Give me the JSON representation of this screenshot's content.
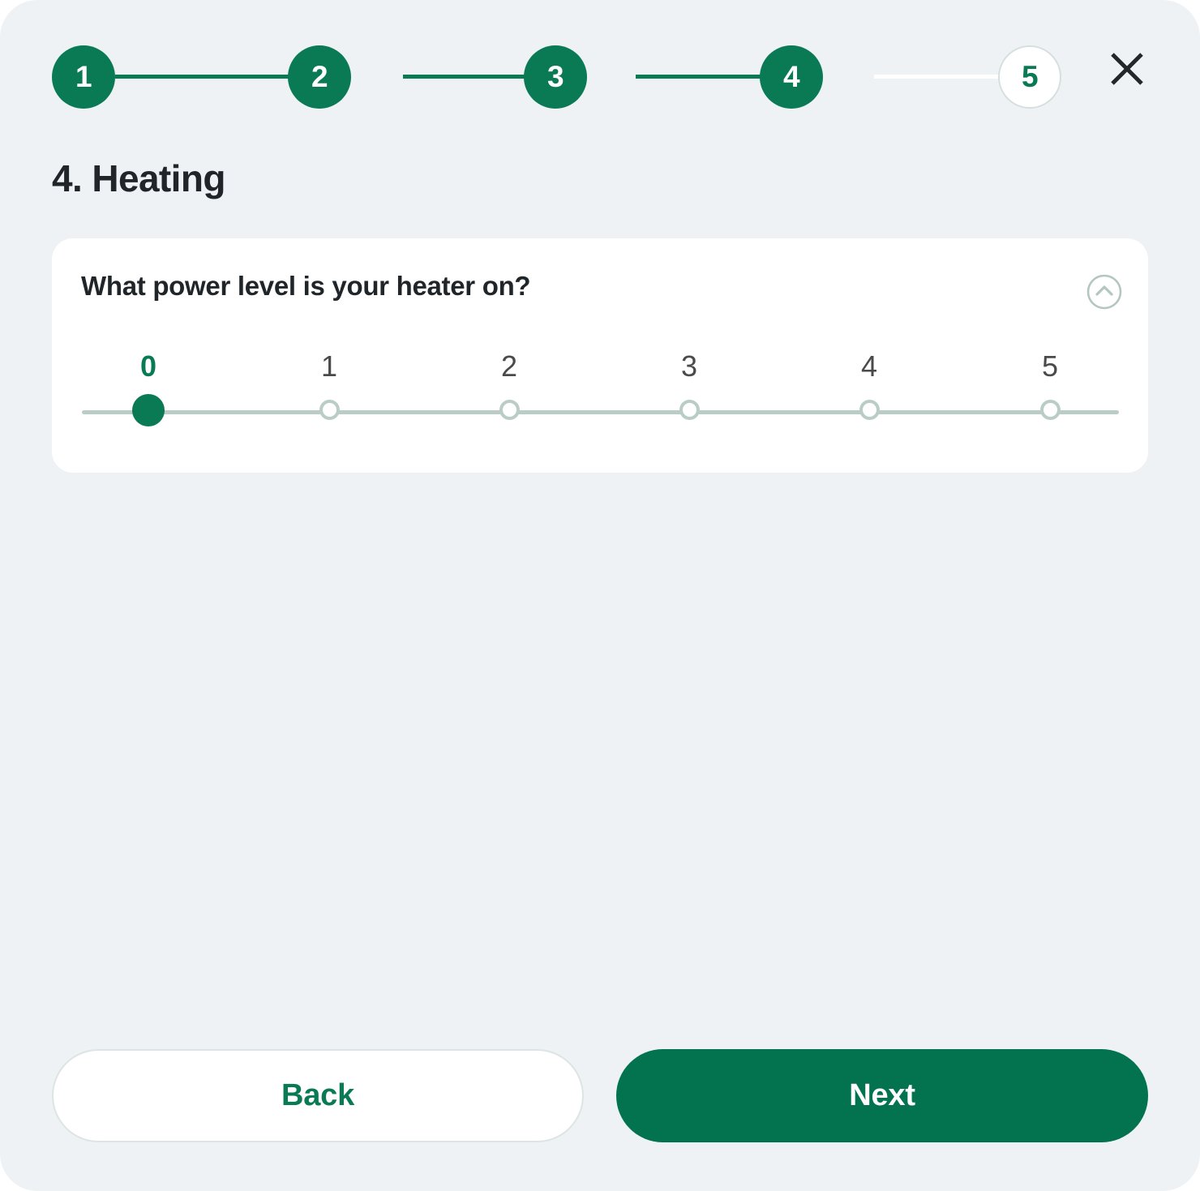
{
  "theme": {
    "page_bg": "#eef2f5",
    "accent_green": "#0a7a55",
    "next_button_green": "#03734f",
    "track_sage": "#b9cdc6",
    "text_dark": "#1f2528"
  },
  "stepper": {
    "steps": [
      {
        "label": "1",
        "state": "done"
      },
      {
        "label": "2",
        "state": "done"
      },
      {
        "label": "3",
        "state": "done"
      },
      {
        "label": "4",
        "state": "done"
      },
      {
        "label": "5",
        "state": "todo"
      }
    ],
    "close_icon": "close-icon"
  },
  "header": {
    "title": "4. Heating"
  },
  "card": {
    "question": "What power level is your heater on?",
    "collapse_icon": "chevron-up-circle-icon",
    "slider": {
      "options": [
        "0",
        "1",
        "2",
        "3",
        "4",
        "5"
      ],
      "selected_index": 0,
      "selected_value": "0"
    }
  },
  "footer": {
    "back_label": "Back",
    "next_label": "Next"
  }
}
